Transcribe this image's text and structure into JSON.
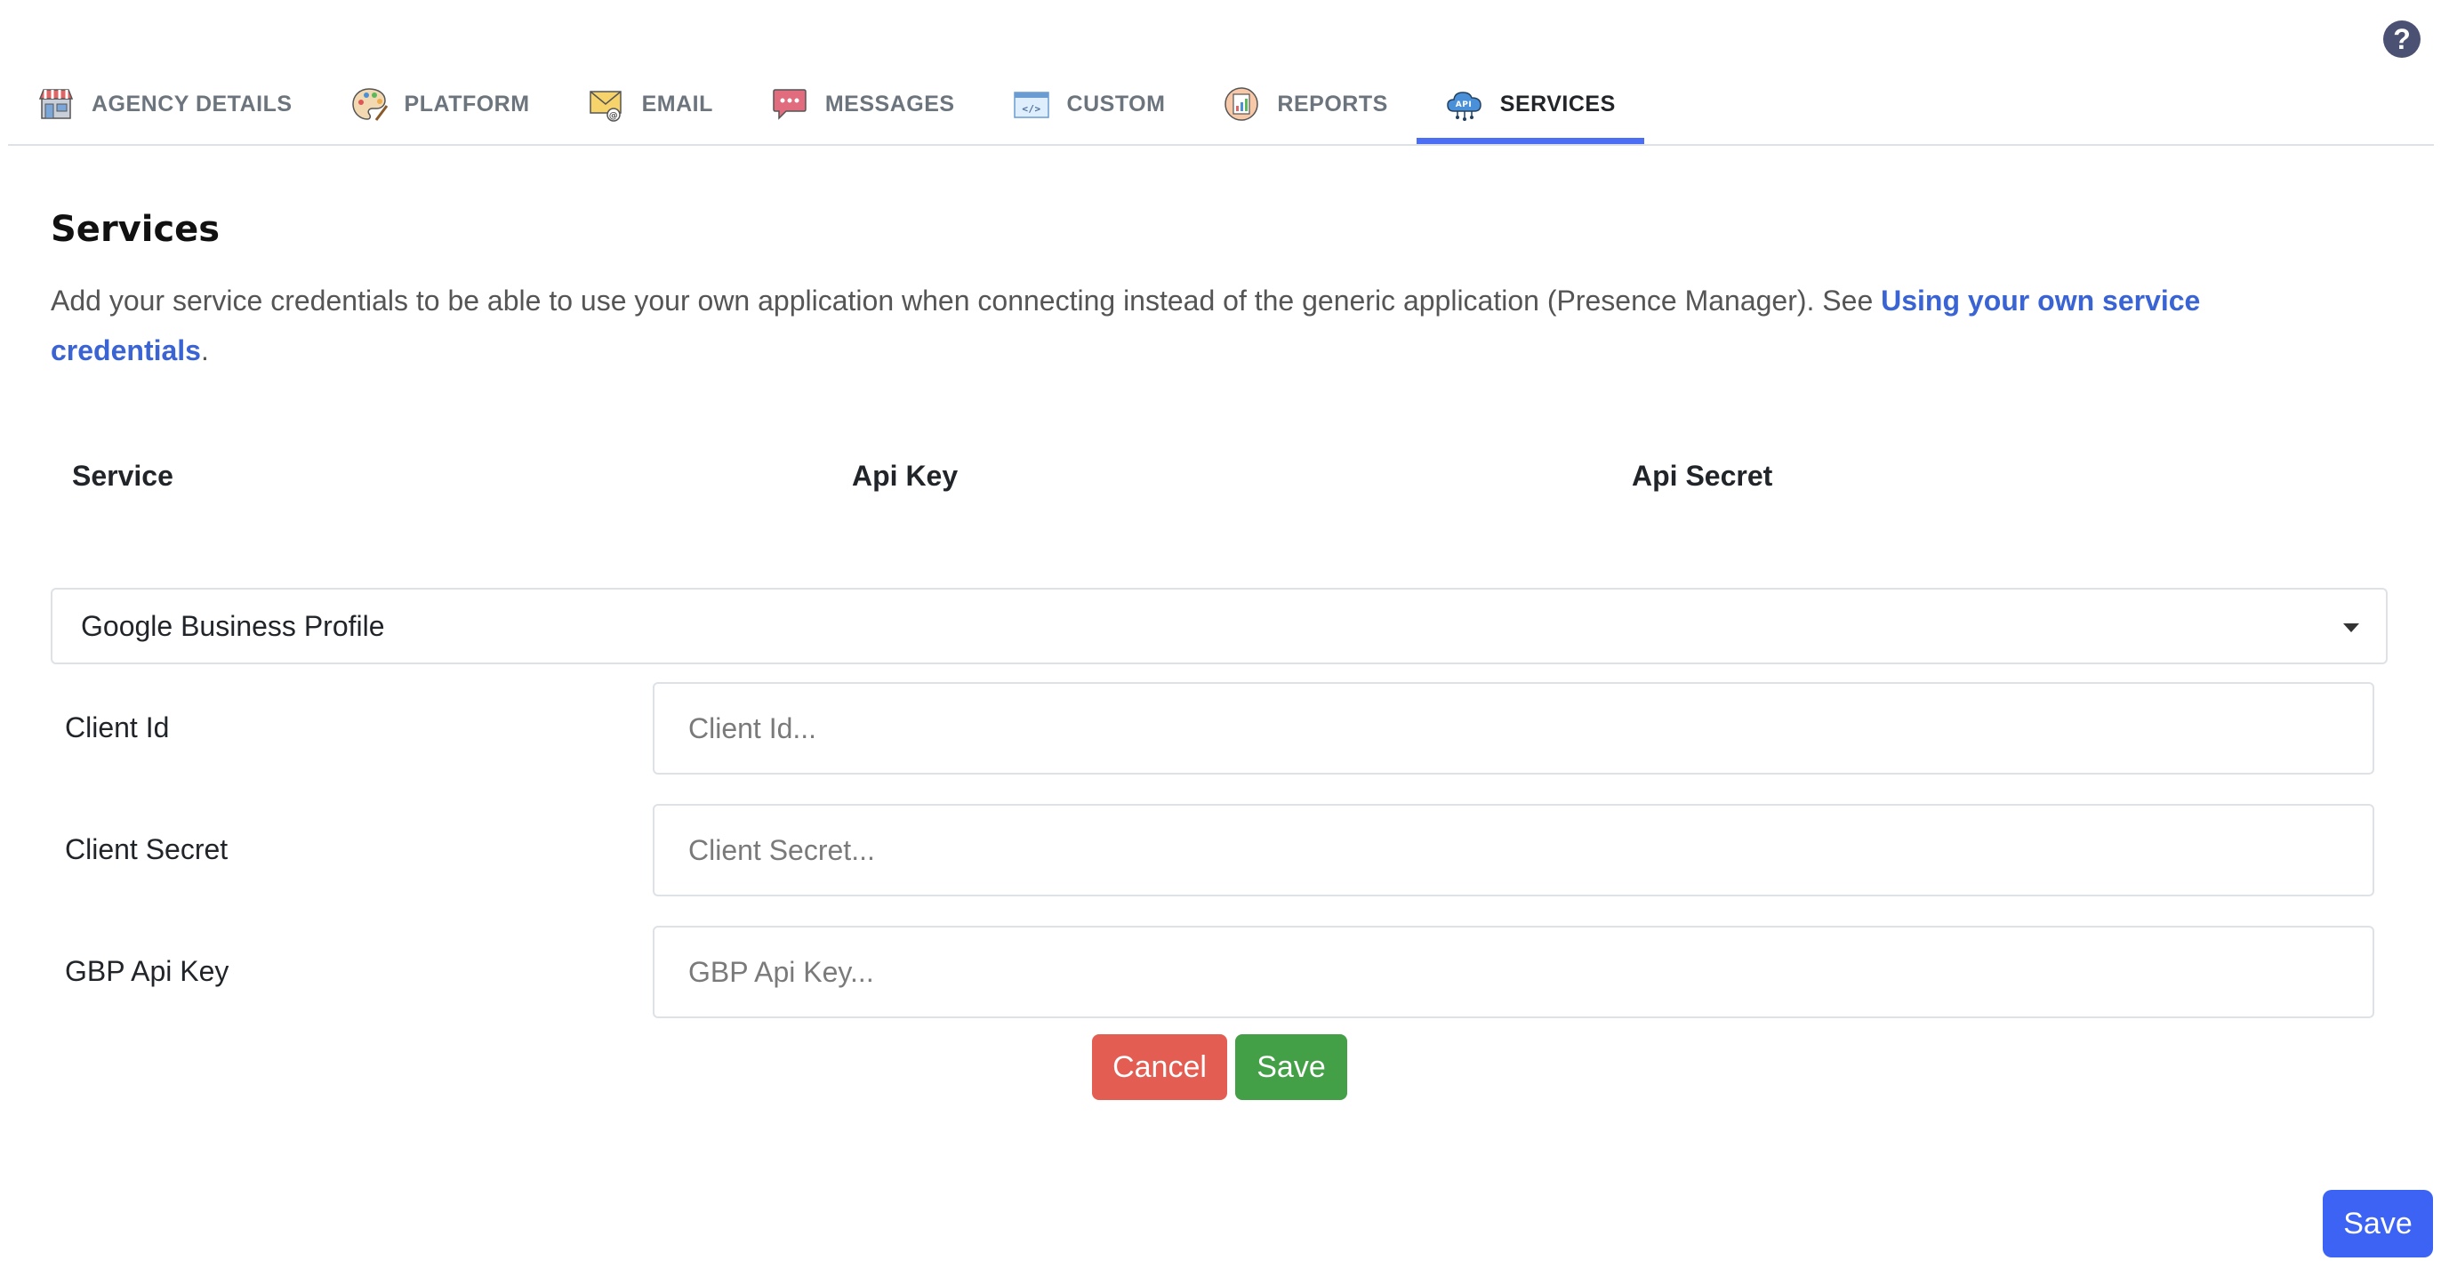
{
  "tabs": [
    {
      "label": "AGENCY DETAILS",
      "icon": "storefront-icon"
    },
    {
      "label": "PLATFORM",
      "icon": "palette-icon"
    },
    {
      "label": "EMAIL",
      "icon": "envelope-icon"
    },
    {
      "label": "MESSAGES",
      "icon": "chat-bubble-icon"
    },
    {
      "label": "CUSTOM",
      "icon": "code-window-icon"
    },
    {
      "label": "REPORTS",
      "icon": "report-icon"
    },
    {
      "label": "SERVICES",
      "icon": "api-cloud-icon",
      "active": true
    }
  ],
  "page": {
    "title": "Services",
    "description": "Add your service credentials to be able to use your own application when connecting instead of the generic application (Presence Manager). See ",
    "link_text": "Using your own service credentials",
    "description_end": "."
  },
  "table_headers": {
    "service": "Service",
    "api_key": "Api Key",
    "api_secret": "Api Secret"
  },
  "service_select": {
    "value": "Google Business Profile"
  },
  "fields": [
    {
      "label": "Client Id",
      "placeholder": "Client Id..."
    },
    {
      "label": "Client Secret",
      "placeholder": "Client Secret..."
    },
    {
      "label": "GBP Api Key",
      "placeholder": "GBP Api Key..."
    }
  ],
  "buttons": {
    "cancel": "Cancel",
    "save_inline": "Save",
    "save_main": "Save"
  },
  "help": {
    "glyph": "?"
  },
  "colors": {
    "accent": "#4c6ef5",
    "cancel": "#e35d52",
    "save_inline": "#43a047",
    "save_main": "#3d63f5",
    "link": "#3a63d4"
  }
}
